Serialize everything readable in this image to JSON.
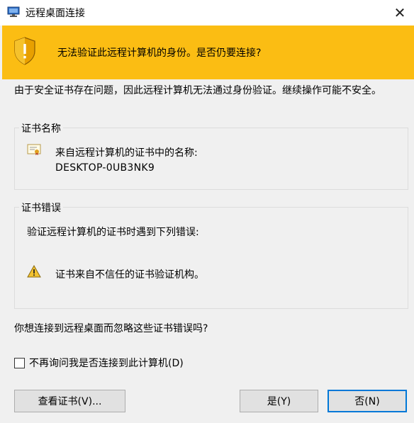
{
  "window": {
    "title": "远程桌面连接",
    "close_glyph": "✕",
    "app_icon": "remote-desktop-icon"
  },
  "banner": {
    "icon": "shield-warning-icon",
    "message": "无法验证此远程计算机的身份。是否仍要连接?",
    "color": "#fbbd13"
  },
  "description": "由于安全证书存在问题，因此远程计算机无法通过身份验证。继续操作可能不安全。",
  "cert_name_group": {
    "legend": "证书名称",
    "icon": "certificate-icon",
    "label": "来自远程计算机的证书中的名称:",
    "value": "DESKTOP-0UB3NK9"
  },
  "cert_error_group": {
    "legend": "证书错误",
    "intro": "验证远程计算机的证书时遇到下列错误:",
    "icon": "warning-icon",
    "error": "证书来自不信任的证书验证机构。"
  },
  "question": "你想连接到远程桌面而忽略这些证书错误吗?",
  "checkbox": {
    "label": "不再询问我是否连接到此计算机(D)",
    "checked": false
  },
  "buttons": {
    "view_cert": "查看证书(V)...",
    "yes": "是(Y)",
    "no": "否(N)"
  },
  "accent_color": "#0078d7"
}
